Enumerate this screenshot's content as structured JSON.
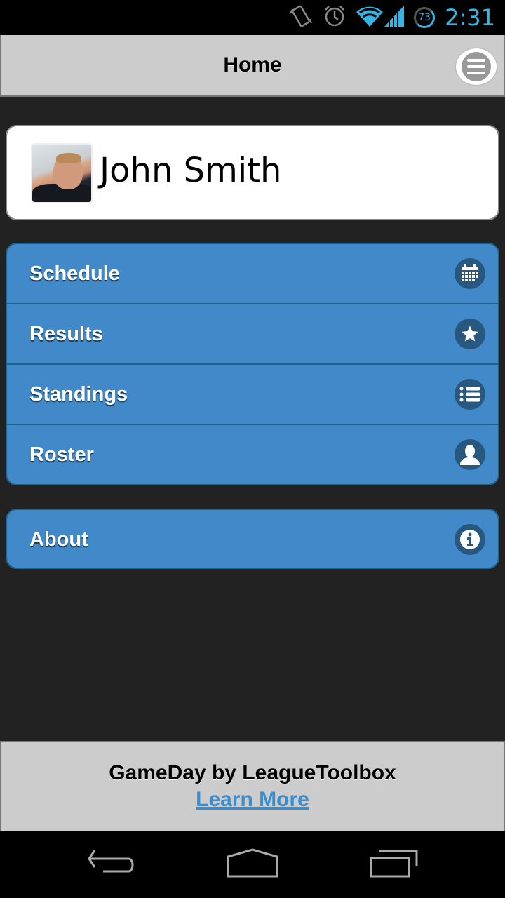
{
  "status_bar": {
    "time": "2:31",
    "battery_level": "73",
    "icons": [
      "vibrate-icon",
      "alarm-icon",
      "wifi-icon",
      "signal-icon",
      "battery-icon"
    ]
  },
  "header": {
    "title": "Home",
    "menu_icon": "hamburger-menu-icon"
  },
  "profile": {
    "name": "John Smith",
    "avatar": "user-photo"
  },
  "menu": {
    "items": [
      {
        "label": "Schedule",
        "icon": "calendar-icon"
      },
      {
        "label": "Results",
        "icon": "star-icon"
      },
      {
        "label": "Standings",
        "icon": "list-icon"
      },
      {
        "label": "Roster",
        "icon": "user-icon"
      }
    ]
  },
  "about": {
    "label": "About",
    "icon": "info-icon"
  },
  "footer": {
    "title": "GameDay by LeagueToolbox",
    "link": "Learn More"
  },
  "nav_bar": {
    "buttons": [
      "back-icon",
      "home-icon",
      "recent-apps-icon"
    ]
  },
  "colors": {
    "accent": "#4189c9",
    "accent_dark": "#285780",
    "status_blue": "#33b5e5",
    "link": "#3a8ed0",
    "background": "#222222",
    "header_bg": "#cccccc"
  }
}
